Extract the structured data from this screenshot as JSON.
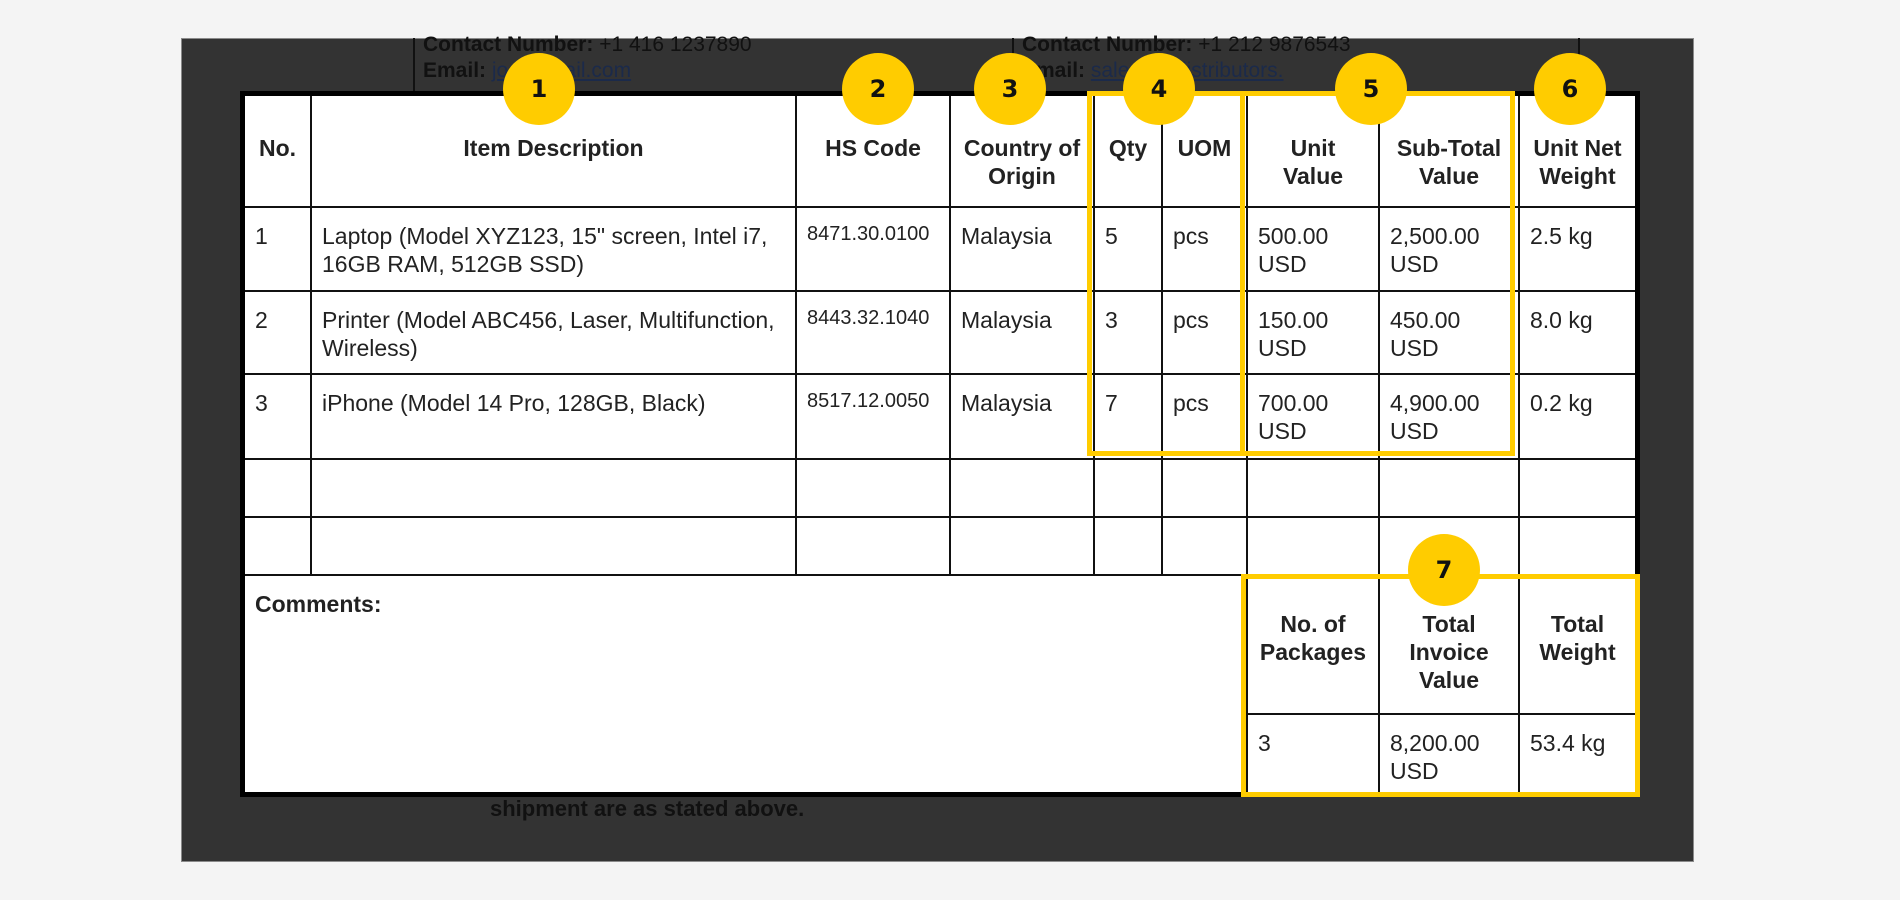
{
  "document_header": {
    "left_contact": {
      "contact_label": "Contact Number:",
      "contact_value": "+1 416 1237890",
      "email_label": "Email:",
      "email_value": "jo      @gmail.com"
    },
    "right_contact": {
      "contact_label": "Contact Number:",
      "contact_value": "+1 212 9876543",
      "email_label": "Email:",
      "email_value": "sale      techdistributors."
    }
  },
  "table": {
    "headers": {
      "no": "No.",
      "item_description": "Item Description",
      "hs_code": "HS Code",
      "country_of_origin": "Country of Origin",
      "qty": "Qty",
      "uom": "UOM",
      "unit_value": "Unit Value",
      "sub_total_value": "Sub-Total Value",
      "unit_net_weight": "Unit Net Weight"
    },
    "rows": [
      {
        "no": "1",
        "item_description": "Laptop (Model XYZ123, 15\" screen, Intel i7, 16GB RAM, 512GB SSD)",
        "hs_code": "8471.30.0100",
        "country_of_origin": "Malaysia",
        "qty": "5",
        "uom": "pcs",
        "unit_value": "500.00 USD",
        "sub_total_value": "2,500.00 USD",
        "unit_net_weight": "2.5 kg"
      },
      {
        "no": "2",
        "item_description": "Printer (Model ABC456, Laser, Multifunction, Wireless)",
        "hs_code": "8443.32.1040",
        "country_of_origin": "Malaysia",
        "qty": "3",
        "uom": "pcs",
        "unit_value": "150.00 USD",
        "sub_total_value": "450.00 USD",
        "unit_net_weight": "8.0 kg"
      },
      {
        "no": "3",
        "item_description": "iPhone (Model 14 Pro, 128GB, Black)",
        "hs_code": "8517.12.0050",
        "country_of_origin": "Malaysia",
        "qty": "7",
        "uom": "pcs",
        "unit_value": "700.00 USD",
        "sub_total_value": "4,900.00 USD",
        "unit_net_weight": "0.2 kg"
      }
    ],
    "empty_rows": 2
  },
  "comments": {
    "label": "Comments:"
  },
  "totals": {
    "headers": {
      "packages": "No. of Packages",
      "total_invoice_value": "Total Invoice Value",
      "total_weight": "Total Weight"
    },
    "values": {
      "packages": "3",
      "total_invoice_value": "8,200.00 USD",
      "total_weight": "53.4 kg"
    }
  },
  "footer_text": "shipment are as stated above.",
  "annotations": {
    "badge_color": "#ffcc00",
    "badges": [
      "1",
      "2",
      "3",
      "4",
      "5",
      "6",
      "7"
    ]
  }
}
